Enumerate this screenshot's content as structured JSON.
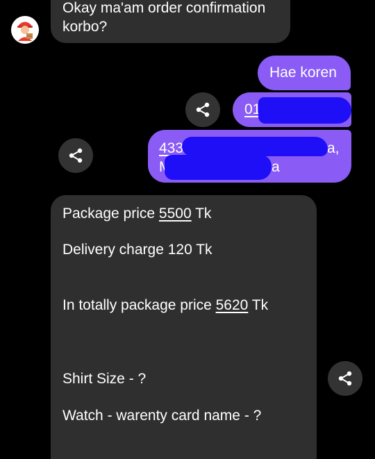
{
  "chat": {
    "msg1": {
      "line1": "Okay ma'am order confirmation",
      "line2": "korbo?"
    },
    "msg2": {
      "text": "Hae koren"
    },
    "msg3": {
      "visible_text": "01"
    },
    "msg4": {
      "line1_start": "433/1",
      "line1_end": "a,",
      "line2_start": "M",
      "line2_end": "a"
    },
    "msg5": {
      "price_prefix": "Package price ",
      "price_value": "5500",
      "price_unit": " Tk",
      "delivery": "Delivery charge 120 Tk",
      "total_prefix": "In totally package price ",
      "total_value": "5620",
      "total_unit": " Tk",
      "shirt": "Shirt Size - ?",
      "watch": "Watch - warenty card name - ?"
    }
  },
  "icons": {
    "share": "share-icon",
    "avatar": "delivery-person-avatar"
  },
  "colors": {
    "background": "#000000",
    "incoming_bubble": "#2f2f2f",
    "outgoing_bubble": "#8a5cf5",
    "share_button": "#333333",
    "redaction": "#1f0ff7"
  }
}
